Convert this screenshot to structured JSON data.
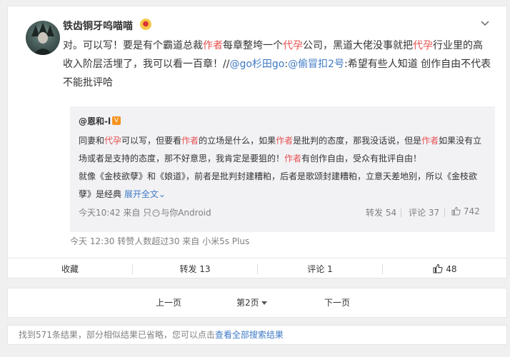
{
  "post": {
    "username": "铁齿铜牙呜喵喵",
    "content": {
      "p1": "对。可以写！要是有个霸道总裁",
      "k1": "作者",
      "p2": "每章整垮一个",
      "k2": "代孕",
      "p3": "公司，黑道大佬没事就把",
      "k3": "代孕",
      "p4": "行业里的高收入阶层活埋了，我可以看一百章！//",
      "at1": "@go杉田go",
      "p5": ":",
      "at2": "@偷冒扣2号",
      "p6": ":希望有些人知道 创作自由不代表不能批评哈"
    },
    "meta": "今天 12:30 转赞人数超过30  来自 小米5s Plus"
  },
  "repost": {
    "user": "@恩和-l",
    "text": {
      "a1": "同妻和",
      "k1": "代孕",
      "a2": "可以写，但要看",
      "k2": "作者",
      "a3": "的立场是什么，如果",
      "k3": "作者",
      "a4": "是批判的态度，那我没话说，但是",
      "k4": "作者",
      "a5": "如果没有立场或者是支持的态度，那不好意思，我肯定是要狙的！",
      "k5": "作者",
      "a6": "有创作自由，受众有批评自由！",
      "a7": "就像《金枝欲孽》和《娘道》，前者是批判封建糟粕，后者是歌颂封建糟粕，立意天差地别，所以《金枝欲孽》是经典",
      "more": "展开全文"
    },
    "meta": "今天10:42 来自 只",
    "meta2": "与你Android",
    "repost_label": "转发 54",
    "comment_label": "评论 37",
    "like_count": "742"
  },
  "actions": {
    "collect": "收藏",
    "repost": "转发 13",
    "comment": "评论 1",
    "like": "48"
  },
  "pager": {
    "prev": "上一页",
    "current": "第2页",
    "next": "下一页"
  },
  "notice": {
    "text": "找到571条结果，部分相似结果已省略，您可以点击",
    "link": "查看全部搜索结果"
  },
  "icons": {
    "more": "chevron-down-icon",
    "like": "thumbs-up-icon",
    "user_badge": "emoji-badge-icon",
    "verified": "verified-v-icon",
    "pager": "caret-down-icon"
  }
}
